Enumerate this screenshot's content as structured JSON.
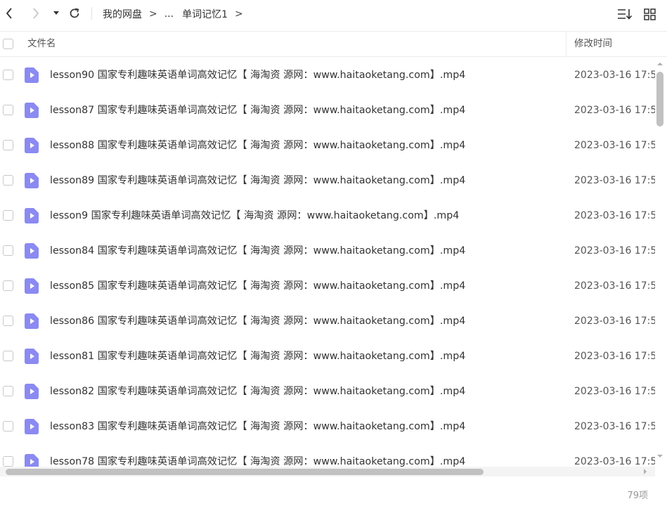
{
  "breadcrumb": {
    "root": "我的网盘",
    "separator": ">",
    "ellipsis": "...",
    "current": "单词记忆1",
    "trailing_separator": ">"
  },
  "header": {
    "name_label": "文件名",
    "time_label": "修改时间"
  },
  "colors": {
    "file_icon": "#8b8af2",
    "text": "#333333",
    "muted": "#999999"
  },
  "files": [
    {
      "name": "lesson90 国家专利趣味英语单词高效记忆【 海淘资 源网：www.haitaoketang.com】.mp4",
      "modified": "2023-03-16 17:5",
      "icon": "video-file-icon"
    },
    {
      "name": "lesson87 国家专利趣味英语单词高效记忆【 海淘资 源网：www.haitaoketang.com】.mp4",
      "modified": "2023-03-16 17:5",
      "icon": "video-file-icon"
    },
    {
      "name": "lesson88 国家专利趣味英语单词高效记忆【 海淘资 源网：www.haitaoketang.com】.mp4",
      "modified": "2023-03-16 17:5",
      "icon": "video-file-icon"
    },
    {
      "name": "lesson89 国家专利趣味英语单词高效记忆【 海淘资 源网：www.haitaoketang.com】.mp4",
      "modified": "2023-03-16 17:5",
      "icon": "video-file-icon"
    },
    {
      "name": "lesson9 国家专利趣味英语单词高效记忆【 海淘资 源网：www.haitaoketang.com】.mp4",
      "modified": "2023-03-16 17:5",
      "icon": "video-file-icon"
    },
    {
      "name": "lesson84 国家专利趣味英语单词高效记忆【 海淘资 源网：www.haitaoketang.com】.mp4",
      "modified": "2023-03-16 17:5",
      "icon": "video-file-icon"
    },
    {
      "name": "lesson85 国家专利趣味英语单词高效记忆【 海淘资 源网：www.haitaoketang.com】.mp4",
      "modified": "2023-03-16 17:5",
      "icon": "video-file-icon"
    },
    {
      "name": "lesson86 国家专利趣味英语单词高效记忆【 海淘资 源网：www.haitaoketang.com】.mp4",
      "modified": "2023-03-16 17:5",
      "icon": "video-file-icon"
    },
    {
      "name": "lesson81 国家专利趣味英语单词高效记忆【 海淘资 源网：www.haitaoketang.com】.mp4",
      "modified": "2023-03-16 17:5",
      "icon": "video-file-icon"
    },
    {
      "name": "lesson82 国家专利趣味英语单词高效记忆【 海淘资 源网：www.haitaoketang.com】.mp4",
      "modified": "2023-03-16 17:5",
      "icon": "video-file-icon"
    },
    {
      "name": "lesson83 国家专利趣味英语单词高效记忆【 海淘资 源网：www.haitaoketang.com】.mp4",
      "modified": "2023-03-16 17:5",
      "icon": "video-file-icon"
    },
    {
      "name": "lesson78 国家专利趣味英语单词高效记忆【 海淘资 源网：www.haitaoketang.com】.mp4",
      "modified": "2023-03-16 17:5",
      "icon": "video-file-icon"
    }
  ],
  "footer": {
    "item_count": "79项"
  }
}
